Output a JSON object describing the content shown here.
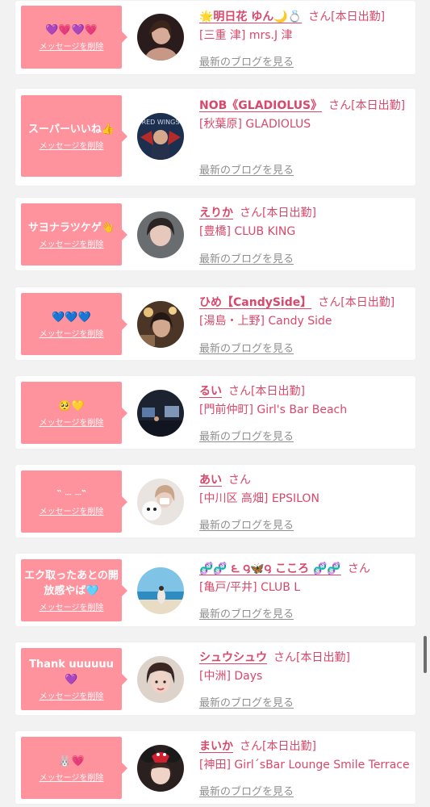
{
  "colors": {
    "accent": "#d9486b",
    "bubble": "#fe939e",
    "muted": "#8f8f8f",
    "background": "#f2f2f2"
  },
  "delete_label": "メッセージを削除",
  "blog_label": "最新のブログを見る",
  "san_label": "さん",
  "entries": [
    {
      "message": "💜💗💜💗",
      "name": "🌟明日花 ゆん🌙💍",
      "status": "[本日出勤]",
      "area": "[三重 津]",
      "shop": "mrs.J 津"
    },
    {
      "message": "スーパーいいね👍",
      "name": "NOB《GLADIOLUS》",
      "status": "[本日出勤]",
      "area": "[秋葉原]",
      "shop": "GLADIOLUS"
    },
    {
      "message": "サヨナラツケゲ👋",
      "name": "えりか",
      "status": "[本日出勤]",
      "area": "[豊橋]",
      "shop": "CLUB KING"
    },
    {
      "message": "💙💙💙",
      "name": "ひめ【CandySide】",
      "status": "[本日出勤]",
      "area": "[湯島・上野]",
      "shop": "Candy Side"
    },
    {
      "message": "🥺💛",
      "name": "るい",
      "status": "[本日出勤]",
      "area": "[門前仲町]",
      "shop": "Girl's Bar Beach"
    },
    {
      "message": "‶ ┈ ┈‶",
      "name": "あい",
      "status": "",
      "area": "[中川区 高畑]",
      "shop": "EPSILON"
    },
    {
      "message": "エク取ったあとの開放感やば🩵",
      "name": "🧬🧬 ౬ ౸🦋౸ こころ 🧬🧬",
      "status": "",
      "area": "[亀戸/平井]",
      "shop": "CLUB L"
    },
    {
      "message": "Thank uuuuuu💜",
      "name": "シュウシュウ",
      "status": "[本日出勤]",
      "area": "[中洲]",
      "shop": "Days"
    },
    {
      "message": "🐰💗",
      "name": "まいか",
      "status": "[本日出勤]",
      "area": "[神田]",
      "shop": "Girl´sBar Lounge Smile Terrace"
    }
  ]
}
